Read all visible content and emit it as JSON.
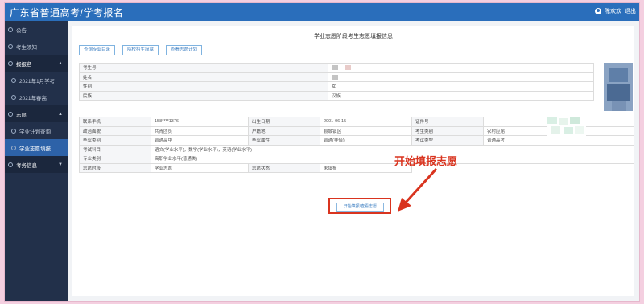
{
  "header": {
    "title": "广东省普通高考/学考报名",
    "user_label": "陈欢欢",
    "logout_label": "退出"
  },
  "sidebar": {
    "items": [
      {
        "label": "公告",
        "type": "item"
      },
      {
        "label": "考生须知",
        "type": "item"
      },
      {
        "label": "报报名",
        "type": "group"
      },
      {
        "label": "2021年1月学考",
        "type": "sub"
      },
      {
        "label": "2021年春高",
        "type": "sub"
      },
      {
        "label": "志愿",
        "type": "group"
      },
      {
        "label": "学业计划查询",
        "type": "sub"
      },
      {
        "label": "学业志愿填报",
        "type": "sub",
        "active": true
      },
      {
        "label": "考务信息",
        "type": "group"
      }
    ]
  },
  "form": {
    "title": "学业志愿阶段考生志愿填报信息",
    "buttons": [
      "查询专业目录",
      "院校招生简章",
      "查看志愿计划"
    ],
    "basic_labels": [
      "考生号",
      "姓名",
      "性别",
      "民族"
    ],
    "basic_values": [
      "",
      "",
      "女",
      "汉族"
    ],
    "details": [
      [
        "联系手机",
        "158****1376",
        "出生日期",
        "2001-06-15",
        "证件号",
        ""
      ],
      [
        "政治面貌",
        "共青团员",
        "户籍地",
        "县城镇区",
        "考生类别",
        "农村应届"
      ],
      [
        "毕业类别",
        "普通高中",
        "毕业属性",
        "普通(非借)",
        "考试类型",
        "普通高考"
      ]
    ],
    "exam_subjects_label": "考试科目",
    "exam_subjects_value": "语文(学业水平)，数学(学业水平)，英语(学业水平)",
    "major_label": "专业类别",
    "major_value": "高职学业水平(普通类)",
    "last_row": [
      "志愿时段",
      "学业志愿",
      "志愿状态",
      "未填报"
    ],
    "start_button": "开始填报/查看志愿"
  },
  "annotation": {
    "text": "开始填报志愿",
    "color": "#d9341f"
  }
}
